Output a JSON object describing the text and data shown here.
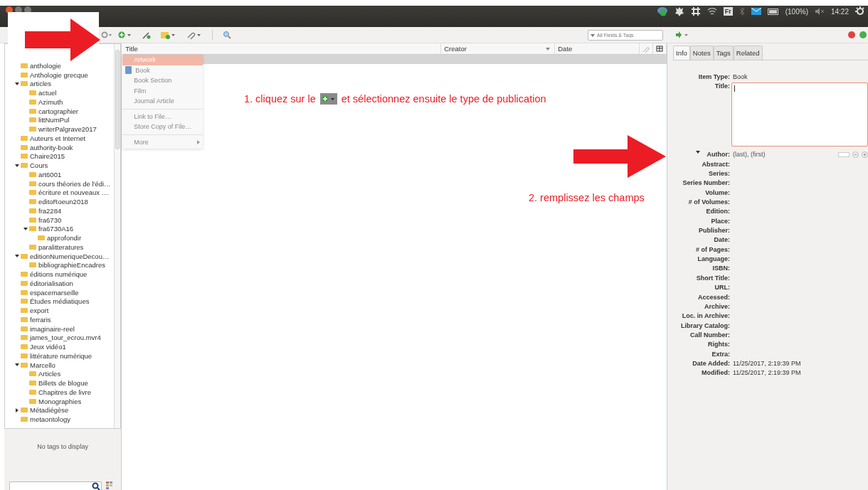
{
  "system_bar": {
    "keyboard": "Fr",
    "battery": "(100%)",
    "clock": "14:22"
  },
  "toolbar": {
    "search": {
      "placeholder": "All Fields & Tags"
    }
  },
  "collections": [
    {
      "name": "anthologie"
    },
    {
      "name": "Anthologie grecque"
    },
    {
      "name": "articles",
      "expanded": true,
      "children": [
        {
          "name": "actuel"
        },
        {
          "name": "Azimuth"
        },
        {
          "name": "cartographier"
        },
        {
          "name": "littNumPul"
        },
        {
          "name": "writerPalgrave2017"
        }
      ]
    },
    {
      "name": "Auteurs et Internet"
    },
    {
      "name": "authority-book"
    },
    {
      "name": "Chaire2015"
    },
    {
      "name": "Cours",
      "expanded": true,
      "children": [
        {
          "name": "art6001"
        },
        {
          "name": "cours théories de l'édi…"
        },
        {
          "name": "écriture et nouveaux …"
        },
        {
          "name": "editoRoeun2018"
        },
        {
          "name": "fra2284"
        },
        {
          "name": "fra6730"
        },
        {
          "name": "fra6730A16",
          "expanded": true,
          "children": [
            {
              "name": "approfondir"
            }
          ]
        },
        {
          "name": "paralitteratures"
        }
      ]
    },
    {
      "name": "editionNumeriqueDecou…",
      "expanded": true,
      "children": [
        {
          "name": "bibliographieEncadres"
        }
      ]
    },
    {
      "name": "éditions numérique"
    },
    {
      "name": "éditorialisation"
    },
    {
      "name": "espacemarseille"
    },
    {
      "name": "Études médiatiques"
    },
    {
      "name": "export"
    },
    {
      "name": "ferraris"
    },
    {
      "name": "imaginaire-reel"
    },
    {
      "name": "james_tour_ecrou.mvr4"
    },
    {
      "name": "Jeux vidéo1"
    },
    {
      "name": "littérature numérique"
    },
    {
      "name": "Marcello",
      "expanded": true,
      "children": [
        {
          "name": "Articles"
        },
        {
          "name": "Billets de blogue"
        },
        {
          "name": "Chapitres de livre"
        },
        {
          "name": "Monographies"
        }
      ]
    },
    {
      "name": "Métadiégèse",
      "expanded": false
    },
    {
      "name": "metaontology"
    }
  ],
  "tags_pane": {
    "empty_text": "No tags to display"
  },
  "items_table": {
    "columns": [
      {
        "label": "Title",
        "kind": "text"
      },
      {
        "label": "Creator",
        "kind": "sort"
      },
      {
        "label": "Date",
        "kind": "text"
      }
    ]
  },
  "new_item_menu": [
    {
      "label": "Artwork",
      "kind": "item",
      "selected": true
    },
    {
      "label": "Book",
      "kind": "item",
      "selected": false,
      "icon": true
    },
    {
      "label": "Book Section",
      "kind": "item",
      "selected": false
    },
    {
      "label": "Film",
      "kind": "item",
      "selected": false
    },
    {
      "label": "Journal Article",
      "kind": "item",
      "selected": false
    },
    {
      "kind": "separator"
    },
    {
      "label": "Link to File…",
      "kind": "item",
      "selected": false
    },
    {
      "label": "Store Copy of File…",
      "kind": "item",
      "selected": false
    },
    {
      "kind": "separator"
    },
    {
      "label": "More",
      "kind": "submenu",
      "selected": false
    }
  ],
  "item_pane": {
    "tabs": [
      {
        "label": "Info",
        "selected": true
      },
      {
        "label": "Notes",
        "selected": false
      },
      {
        "label": "Tags",
        "selected": false
      },
      {
        "label": "Related",
        "selected": false
      }
    ],
    "fields": [
      {
        "label": "Item Type:",
        "kind": "text",
        "value": "Book"
      },
      {
        "label": "Title:",
        "kind": "textarea"
      },
      {
        "label": "Author:",
        "kind": "creator",
        "value": "(last), (first)"
      },
      {
        "label": "Abstract:",
        "kind": "text"
      },
      {
        "label": "Series:",
        "kind": "text"
      },
      {
        "label": "Series Number:",
        "kind": "text"
      },
      {
        "label": "Volume:",
        "kind": "text"
      },
      {
        "label": "# of Volumes:",
        "kind": "text"
      },
      {
        "label": "Edition:",
        "kind": "text"
      },
      {
        "label": "Place:",
        "kind": "text"
      },
      {
        "label": "Publisher:",
        "kind": "text"
      },
      {
        "label": "Date:",
        "kind": "text"
      },
      {
        "label": "# of Pages:",
        "kind": "text"
      },
      {
        "label": "Language:",
        "kind": "text"
      },
      {
        "label": "ISBN:",
        "kind": "text"
      },
      {
        "label": "Short Title:",
        "kind": "text"
      },
      {
        "label": "URL:",
        "kind": "text"
      },
      {
        "label": "Accessed:",
        "kind": "text"
      },
      {
        "label": "Archive:",
        "kind": "text"
      },
      {
        "label": "Loc. in Archive:",
        "kind": "text"
      },
      {
        "label": "Library Catalog:",
        "kind": "text"
      },
      {
        "label": "Call Number:",
        "kind": "text"
      },
      {
        "label": "Rights:",
        "kind": "text"
      },
      {
        "label": "Extra:",
        "kind": "text"
      },
      {
        "label": "Date Added:",
        "kind": "text",
        "value": "11/25/2017, 2:19:39 PM"
      },
      {
        "label": "Modified:",
        "kind": "text",
        "value": "11/25/2017, 2:19:39 PM"
      }
    ]
  },
  "annotations": {
    "step1": {
      "before": "1. cliquez sur le",
      "after": "et sélectionnez ensuite le type de publication"
    },
    "step2": "2. remplissez les champs"
  }
}
